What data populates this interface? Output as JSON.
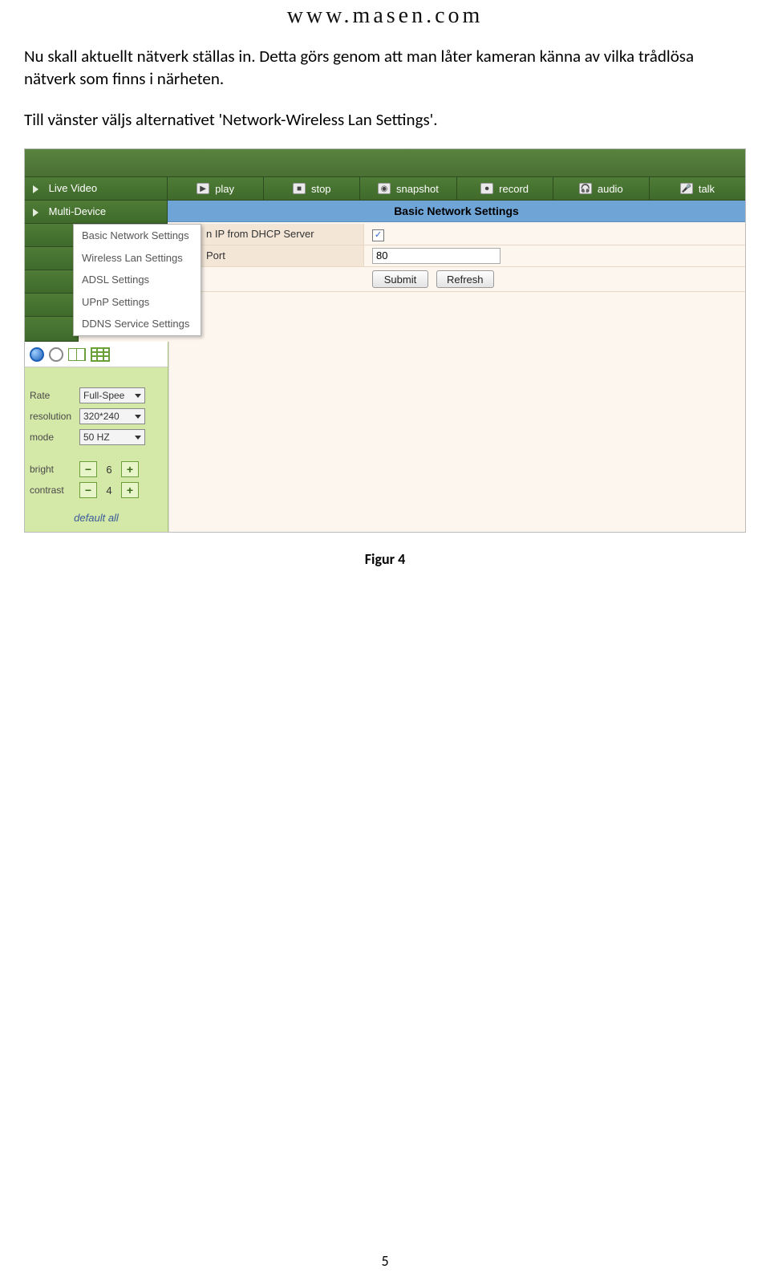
{
  "header_url": "www.masen.com",
  "paragraph": "Nu skall aktuellt nätverk ställas in. Detta görs genom att man låter kameran känna av vilka trådlösa nätverk som finns i närheten.",
  "paragraph2": "Till vänster väljs alternativet 'Network-Wireless Lan Settings'.",
  "caption": "Figur 4",
  "page_number": "5",
  "screenshot": {
    "nav": {
      "live_video": "Live Video",
      "multi_device": "Multi-Device"
    },
    "toolbar": {
      "play": "play",
      "stop": "stop",
      "snapshot": "snapshot",
      "record": "record",
      "audio": "audio",
      "talk": "talk"
    },
    "section_title": "Basic Network Settings",
    "form": {
      "dhcp_label_frag": "n IP from DHCP Server",
      "dhcp_checked": "✓",
      "port_label_frag": "Port",
      "port_value": "80",
      "submit": "Submit",
      "refresh": "Refresh"
    },
    "popup": [
      "Basic Network Settings",
      "Wireless Lan Settings",
      "ADSL Settings",
      "UPnP Settings",
      "DDNS Service Settings"
    ],
    "controls": {
      "rate_label": "Rate",
      "rate_value": "Full-Spee",
      "resolution_label": "resolution",
      "resolution_value": "320*240",
      "mode_label": "mode",
      "mode_value": "50 HZ",
      "bright_label": "bright",
      "bright_value": "6",
      "contrast_label": "contrast",
      "contrast_value": "4",
      "default_all": "default all"
    }
  }
}
